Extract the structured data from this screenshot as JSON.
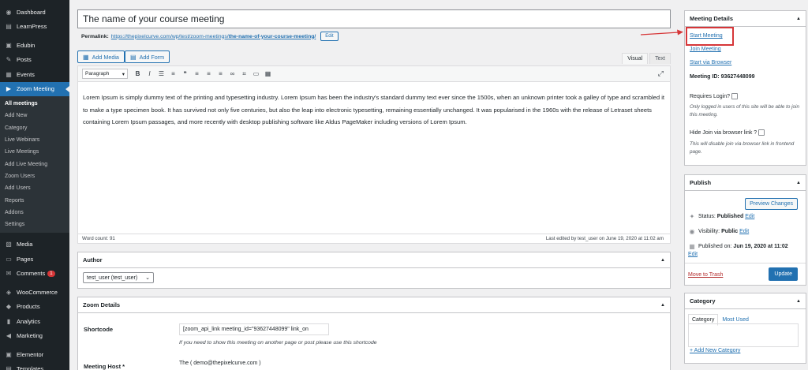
{
  "sidebar": {
    "top_items": [
      {
        "label": "Dashboard",
        "icon": "dashboard-icon",
        "glyph": "◉"
      },
      {
        "label": "LearnPress",
        "icon": "graduation-cap-icon",
        "glyph": "▤"
      }
    ],
    "mid_items": [
      {
        "label": "Edubin",
        "icon": "edubin-icon",
        "glyph": "▣"
      },
      {
        "label": "Posts",
        "icon": "pin-icon",
        "glyph": "✎"
      },
      {
        "label": "Events",
        "icon": "calendar-icon",
        "glyph": "▦"
      }
    ],
    "active_item": {
      "label": "Zoom Meeting",
      "icon": "video-icon",
      "glyph": "▶"
    },
    "submenu": [
      "All meetings",
      "Add New",
      "Category",
      "Live Webinars",
      "Live Meetings",
      "Add Live Meeting",
      "Zoom Users",
      "Add Users",
      "Reports",
      "Addons",
      "Settings"
    ],
    "after_items": [
      {
        "label": "Media",
        "icon": "media-icon",
        "glyph": "▧"
      },
      {
        "label": "Pages",
        "icon": "pages-icon",
        "glyph": "▭"
      },
      {
        "label": "Comments",
        "icon": "comments-icon",
        "glyph": "✉",
        "badge": "1"
      }
    ],
    "shop_items": [
      {
        "label": "WooCommerce",
        "icon": "woocommerce-icon",
        "glyph": "◈"
      },
      {
        "label": "Products",
        "icon": "products-icon",
        "glyph": "◆"
      },
      {
        "label": "Analytics",
        "icon": "analytics-icon",
        "glyph": "▮"
      },
      {
        "label": "Marketing",
        "icon": "megaphone-icon",
        "glyph": "◀"
      }
    ],
    "bottom_items": [
      {
        "label": "Elementor",
        "icon": "elementor-icon",
        "glyph": "▣"
      },
      {
        "label": "Templates",
        "icon": "templates-icon",
        "glyph": "▤"
      }
    ]
  },
  "post": {
    "title": "The name of your course meeting",
    "permalink_label": "Permalink:",
    "permalink_base": "https://thepixelcurve.com/wp/test/zoom-meetings/",
    "permalink_slug": "the-name-of-your-course-meeting/",
    "edit_label": "Edit"
  },
  "buttons": {
    "add_media": "Add Media",
    "add_form": "Add Form"
  },
  "editor": {
    "tab_visual": "Visual",
    "tab_text": "Text",
    "format_select": "Paragraph",
    "content": "Lorem Ipsum is simply dummy text of the printing and typesetting industry. Lorem Ipsum has been the industry's standard dummy text ever since the 1500s, when an unknown printer took a galley of type and scrambled it to make a type specimen book. It has survived not only five centuries, but also the leap into electronic typesetting, remaining essentially unchanged. It was popularised in the 1960s with the release of Letraset sheets containing Lorem Ipsum passages, and more recently with desktop publishing software like Aldus PageMaker including versions of Lorem Ipsum.",
    "word_count": "Word count: 91",
    "last_edited": "Last edited by test_user on June 19, 2020 at 11:02 am"
  },
  "author_box": {
    "title": "Author",
    "value": "test_user (test_user)"
  },
  "zoom_details": {
    "title": "Zoom Details",
    "shortcode_label": "Shortcode",
    "shortcode_value": "[zoom_api_link meeting_id=\"93627448099\" link_on",
    "shortcode_hint": "If you need to show this meeting on another page or post please use this shortcode",
    "host_label": "Meeting Host *",
    "host_value": "The ( demo@thepixelcurve.com )"
  },
  "meeting_details": {
    "title": "Meeting Details",
    "start_meeting": "Start Meeting",
    "join_meeting": "Join Meeting",
    "start_browser": "Start via Browser",
    "meeting_id": "Meeting ID: 93627448099",
    "requires_login": "Requires Login?",
    "requires_login_hint": "Only logged in users of this site will be able to join this meeting.",
    "hide_join": "Hide Join via browser link ?",
    "hide_join_hint": "This will disable join via browser link in frontend page."
  },
  "publish": {
    "title": "Publish",
    "preview": "Preview Changes",
    "status_label": "Status:",
    "status_value": "Published",
    "visibility_label": "Visibility:",
    "visibility_value": "Public",
    "published_label": "Published on:",
    "published_value": "Jun 19, 2020 at 11:02",
    "edit": "Edit",
    "trash": "Move to Trash",
    "update": "Update"
  },
  "category": {
    "title": "Category",
    "tab_category": "Category",
    "tab_most_used": "Most Used",
    "add_new": "+ Add New Category"
  },
  "colors": {
    "accent": "#2271b1",
    "highlight": "#d63638",
    "sidebar": "#1d2327"
  }
}
